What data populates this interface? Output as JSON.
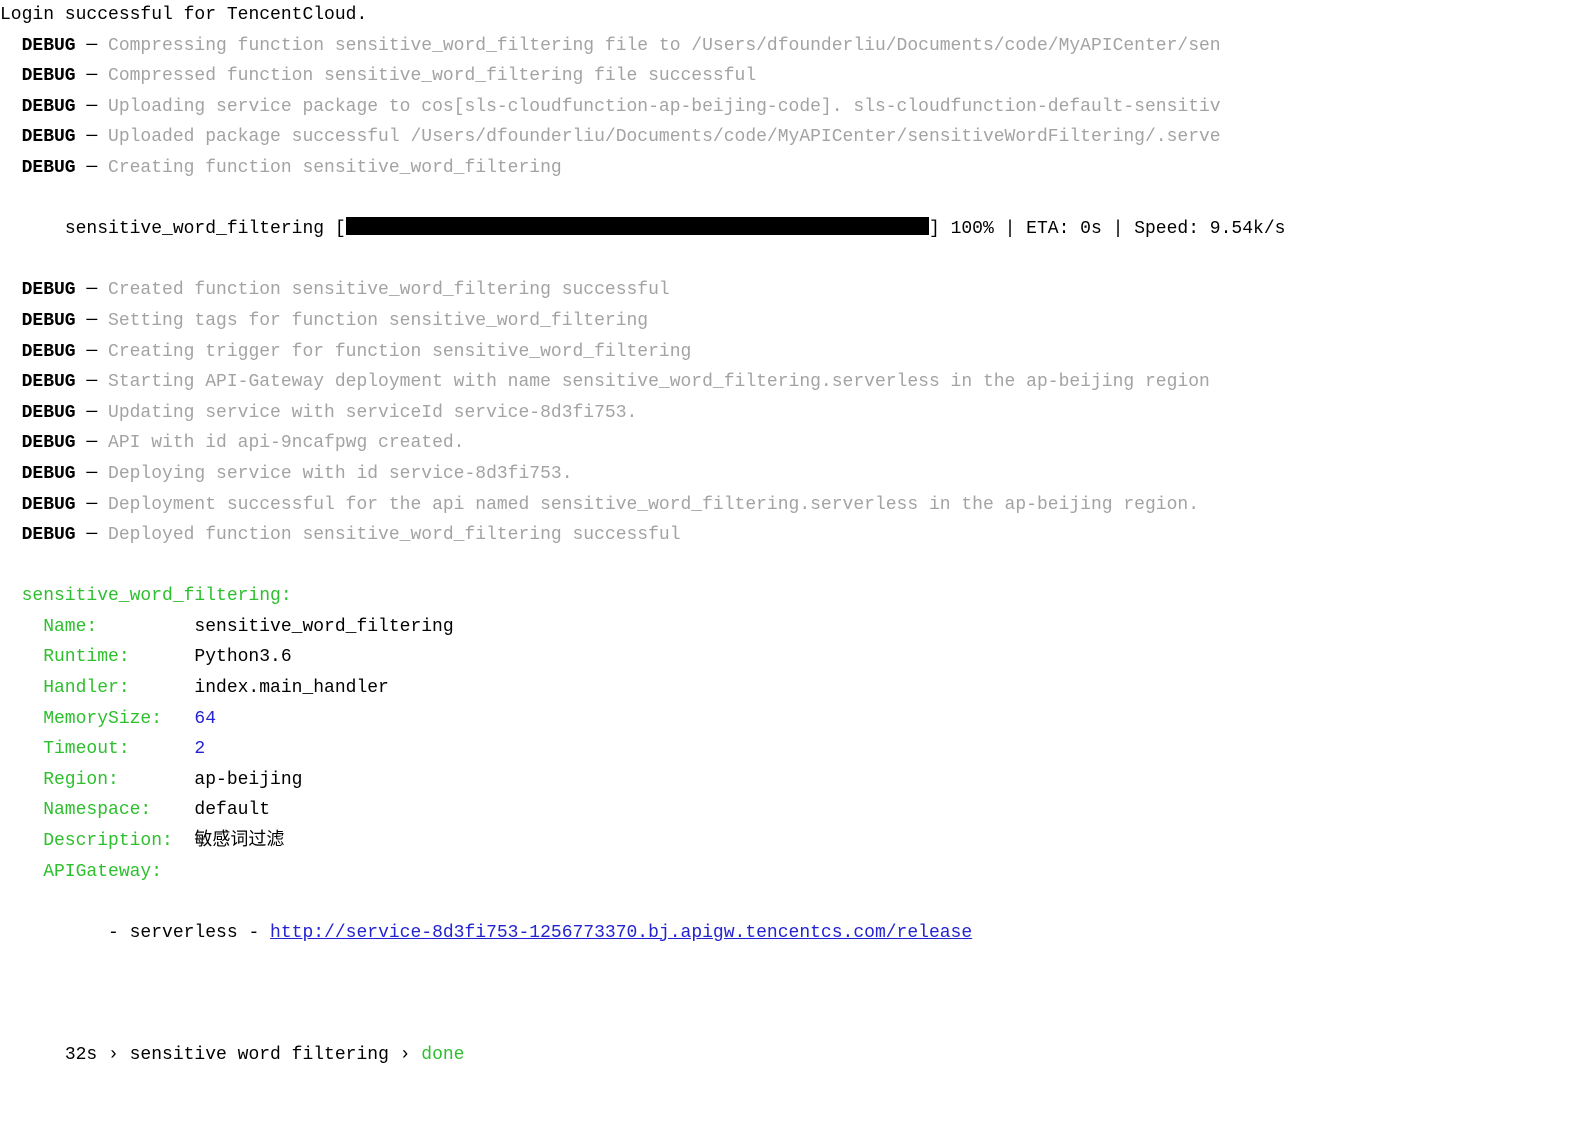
{
  "login_line": "Login successful for TencentCloud.",
  "debug_label": "DEBUG",
  "sep": " ─ ",
  "debug_lines_pre": [
    "Compressing function sensitive_word_filtering file to /Users/dfounderliu/Documents/code/MyAPICenter/sen",
    "Compressed function sensitive_word_filtering file successful",
    "Uploading service package to cos[sls-cloudfunction-ap-beijing-code]. sls-cloudfunction-default-sensitiv",
    "Uploaded package successful /Users/dfounderliu/Documents/code/MyAPICenter/sensitiveWordFiltering/.serve",
    "Creating function sensitive_word_filtering"
  ],
  "progress": {
    "name": "sensitive_word_filtering",
    "open": " [",
    "close": "] ",
    "stats": "100% | ETA: 0s | Speed: 9.54k/s"
  },
  "debug_lines_post": [
    "Created function sensitive_word_filtering successful",
    "Setting tags for function sensitive_word_filtering",
    "Creating trigger for function sensitive_word_filtering",
    "Starting API-Gateway deployment with name sensitive_word_filtering.serverless in the ap-beijing region",
    "Updating service with serviceId service-8d3fi753.",
    "API with id api-9ncafpwg created.",
    "Deploying service with id service-8d3fi753.",
    "Deployment successful for the api named sensitive_word_filtering.serverless in the ap-beijing region.",
    "Deployed function sensitive_word_filtering successful"
  ],
  "summary": {
    "header": "sensitive_word_filtering:",
    "kv": [
      {
        "key": "Name:",
        "val": "sensitive_word_filtering",
        "num": false
      },
      {
        "key": "Runtime:",
        "val": "Python3.6",
        "num": false
      },
      {
        "key": "Handler:",
        "val": "index.main_handler",
        "num": false
      },
      {
        "key": "MemorySize:",
        "val": "64",
        "num": true
      },
      {
        "key": "Timeout:",
        "val": "2",
        "num": true
      },
      {
        "key": "Region:",
        "val": "ap-beijing",
        "num": false
      },
      {
        "key": "Namespace:",
        "val": "default",
        "num": false
      },
      {
        "key": "Description:",
        "val": "敏感词过滤",
        "num": false
      }
    ],
    "apigw_label": "APIGateway:",
    "apigw_prefix": "- serverless - ",
    "apigw_url": "http://service-8d3fi753-1256773370.bj.apigw.tencentcs.com/release"
  },
  "statusline": {
    "time": "32s",
    "sep": " › ",
    "name": "sensitive word filtering",
    "done": "done"
  }
}
